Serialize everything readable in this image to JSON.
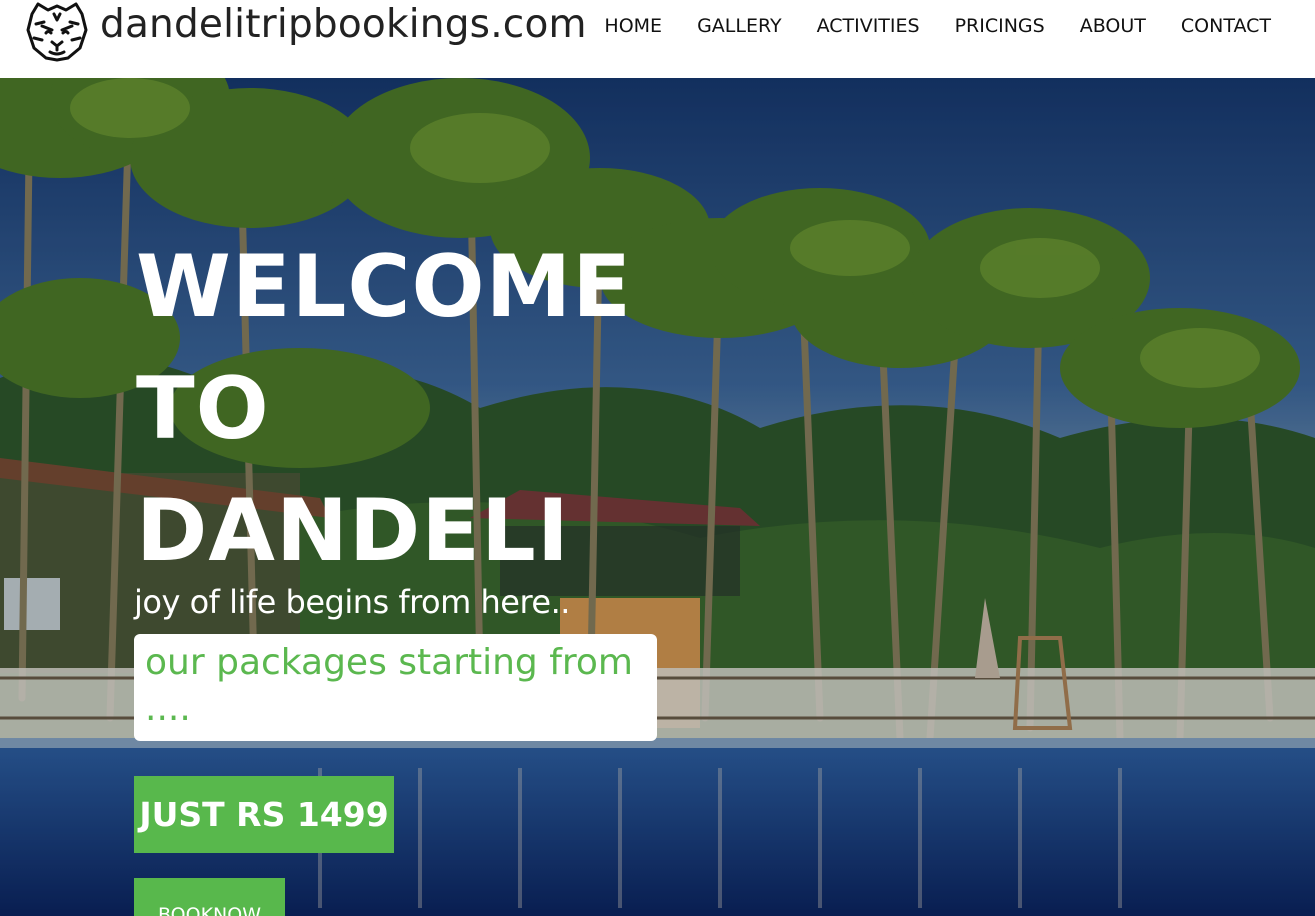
{
  "header": {
    "site_name": "dandelitripbookings.com",
    "logo_icon": "tiger-head-icon"
  },
  "nav": {
    "items": [
      "HOME",
      "GALLERY",
      "ACTIVITIES",
      "PRICINGS",
      "ABOUT",
      "CONTACT"
    ]
  },
  "hero": {
    "title_lines": [
      "WELCOME",
      "TO",
      "DANDELI"
    ],
    "tagline": "joy of life begins from here..",
    "package_text": "our packages starting from ....",
    "price_button": "JUST RS 1499",
    "book_button": "BOOKNOW",
    "background": "palm-trees-pool-resort-photo"
  },
  "colors": {
    "accent_green": "#58b84c",
    "package_text_green": "#5bb84f",
    "header_bg": "#ffffff"
  }
}
